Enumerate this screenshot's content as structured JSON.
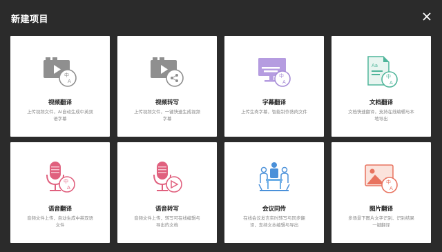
{
  "dialog": {
    "title": "新建项目"
  },
  "cards": [
    {
      "title": "视频翻译",
      "desc": "上传视频文件，AI自动生成中英双语字幕",
      "icon": "video-translate-icon"
    },
    {
      "title": "视频转写",
      "desc": "上传视频文件，一键快速生成视频字幕",
      "icon": "video-transcribe-icon"
    },
    {
      "title": "字幕翻译",
      "desc": "上传生肉字幕，智能制作熟肉文件",
      "icon": "subtitle-translate-icon"
    },
    {
      "title": "文档翻译",
      "desc": "文档快速翻译，支持在线编辑与本地导出",
      "icon": "document-translate-icon"
    },
    {
      "title": "语音翻译",
      "desc": "音频文件上传，自动生成中英双语文件",
      "icon": "speech-translate-icon"
    },
    {
      "title": "语音转写",
      "desc": "音频文件上传，转写可在线编辑与导出的文档",
      "icon": "speech-transcribe-icon"
    },
    {
      "title": "会议同传",
      "desc": "在线会议发言实时转写与同步翻译，支持文本编辑与导出",
      "icon": "meeting-interpret-icon"
    },
    {
      "title": "图片翻译",
      "desc": "多场景下图片文字识别、识别结果一键翻译",
      "icon": "image-translate-icon"
    }
  ],
  "colors": {
    "background": "#2b2b2b",
    "card": "#ffffff",
    "gray_icon": "#9a9a9a",
    "purple": "#a58bd6",
    "green": "#4fb59a",
    "pink": "#e0607e",
    "blue": "#4a90d9",
    "coral": "#e8735f"
  }
}
